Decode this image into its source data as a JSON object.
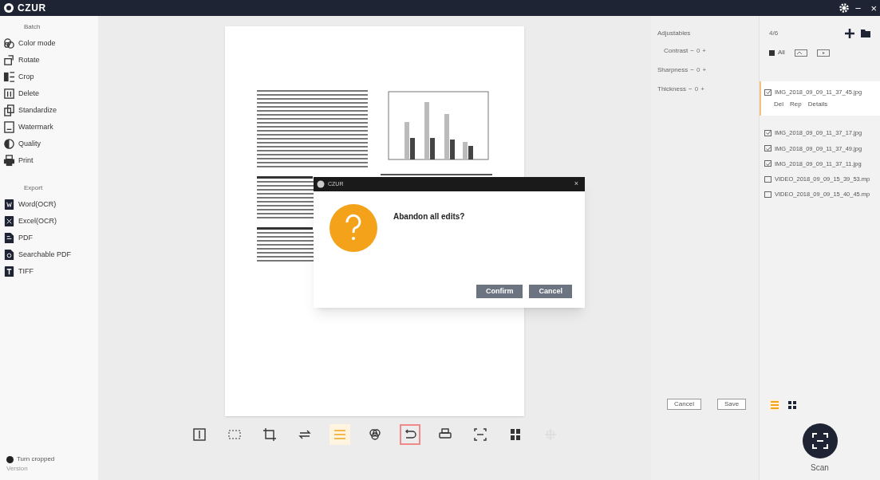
{
  "window": {
    "title": "CZUR",
    "controls": [
      "−",
      "×"
    ]
  },
  "sidebar": {
    "sections": [
      {
        "heading": "Batch",
        "items": [
          {
            "label": "Color mode",
            "kind": "colormode"
          },
          {
            "label": "Rotate",
            "kind": "rotate"
          },
          {
            "label": "Crop",
            "kind": "crop"
          },
          {
            "label": "Delete",
            "kind": "delete"
          },
          {
            "label": "Standardize",
            "kind": "standardize"
          },
          {
            "label": "Watermark",
            "kind": "watermark"
          },
          {
            "label": "Quality",
            "kind": "quality"
          },
          {
            "label": "Print",
            "kind": "print"
          }
        ]
      },
      {
        "heading": "Export",
        "items": [
          {
            "label": "Word(OCR)",
            "kind": "word"
          },
          {
            "label": "Excel(OCR)",
            "kind": "excel"
          },
          {
            "label": "PDF",
            "kind": "pdf"
          },
          {
            "label": "Searchable PDF",
            "kind": "spdf"
          },
          {
            "label": "TIFF",
            "kind": "tiff"
          }
        ]
      }
    ],
    "footer": {
      "label": "Turn cropped",
      "checked": true,
      "version": "Version"
    }
  },
  "toolbar": [
    {
      "kind": "split",
      "active": false,
      "selected": false
    },
    {
      "kind": "select",
      "active": false,
      "selected": false
    },
    {
      "kind": "crop",
      "active": false,
      "selected": false
    },
    {
      "kind": "swap",
      "active": false,
      "selected": false
    },
    {
      "kind": "adjust",
      "active": true,
      "selected": false
    },
    {
      "kind": "color",
      "active": false,
      "selected": false
    },
    {
      "kind": "undo",
      "active": false,
      "selected": true
    },
    {
      "kind": "print",
      "active": false,
      "selected": false
    },
    {
      "kind": "ocr",
      "active": false,
      "selected": false
    },
    {
      "kind": "layout",
      "active": false,
      "selected": false
    },
    {
      "kind": "crosshair",
      "active": false,
      "selected": false,
      "disabled": true
    }
  ],
  "adjust_panel": {
    "title": "Adjustables",
    "rows": [
      {
        "label": "Contrast",
        "minus": "−",
        "value": "0",
        "plus": "+"
      },
      {
        "label": "Sharpness",
        "minus": "−",
        "value": "0",
        "plus": "+"
      },
      {
        "label": "Thickness",
        "minus": "−",
        "value": "0",
        "plus": "+"
      }
    ],
    "buttons": [
      "Cancel",
      "Save"
    ]
  },
  "file_panel": {
    "count": "4/6",
    "all": {
      "label": "All",
      "checked": true
    },
    "files": [
      {
        "name": "IMG_2018_09_09_11_37_45.jpg",
        "checked": true,
        "selected": true,
        "actions": [
          "Del",
          "Rep",
          "Details"
        ]
      },
      {
        "name": "IMG_2018_09_09_11_37_17.jpg",
        "checked": true,
        "selected": false
      },
      {
        "name": "IMG_2018_09_09_11_37_49.jpg",
        "checked": true,
        "selected": false
      },
      {
        "name": "IMG_2018_09_09_11_37_11.jpg",
        "checked": true,
        "selected": false
      },
      {
        "name": "VIDEO_2018_09_09_15_39_53.mp",
        "checked": false,
        "selected": false
      },
      {
        "name": "VIDEO_2018_09_09_15_40_45.mp",
        "checked": false,
        "selected": false
      }
    ],
    "view_modes": [
      {
        "kind": "list",
        "selected": true
      },
      {
        "kind": "grid",
        "selected": false
      }
    ],
    "scan": "Scan"
  },
  "dialog": {
    "title": "CZUR",
    "close": "×",
    "message": "Abandon all edits?",
    "buttons": [
      "Confirm",
      "Cancel"
    ]
  }
}
